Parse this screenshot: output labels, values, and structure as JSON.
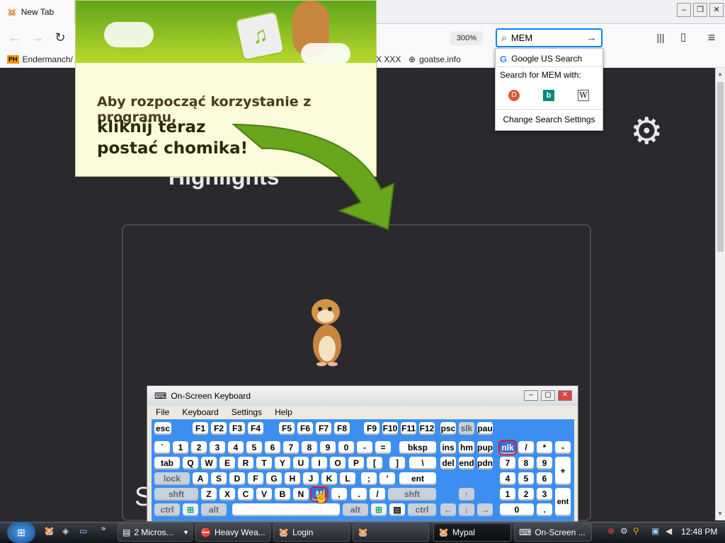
{
  "browser": {
    "tab_title": "New Tab",
    "zoom": "300%",
    "search": {
      "value": "MEM"
    },
    "bookmarks": [
      {
        "label": "Endermanch/",
        "icon": "PH"
      },
      {
        "label": "X XXX"
      },
      {
        "label": "goatse.info"
      }
    ],
    "search_popup": {
      "engine": "Google US Search",
      "search_with": "Search for MEM with:",
      "change_settings": "Change Search Settings"
    }
  },
  "page": {
    "heading": "Highlights",
    "side_letter": "S"
  },
  "ad": {
    "line1": "Aby rozpocząć korzystanie z programu,",
    "line2": "kliknij teraz",
    "line3": "postać chomika!"
  },
  "osk": {
    "title": "On-Screen Keyboard",
    "menu": [
      "File",
      "Keyboard",
      "Settings",
      "Help"
    ],
    "keys": {
      "esc": "esc",
      "f1": "F1",
      "f2": "F2",
      "f3": "F3",
      "f4": "F4",
      "f5": "F5",
      "f6": "F6",
      "f7": "F7",
      "f8": "F8",
      "f9": "F9",
      "f10": "F10",
      "f11": "F11",
      "f12": "F12",
      "psc": "psc",
      "slk": "slk",
      "pau": "pau",
      "grave": "`",
      "n1": "1",
      "n2": "2",
      "n3": "3",
      "n4": "4",
      "n5": "5",
      "n6": "6",
      "n7": "7",
      "n8": "8",
      "n9": "9",
      "n0": "0",
      "minus": "-",
      "equal": "=",
      "bksp": "bksp",
      "ins": "ins",
      "hm": "hm",
      "pup": "pup",
      "nlk": "nlk",
      "ndiv": "/",
      "nmul": "*",
      "nsub": "-",
      "tab": "tab",
      "q": "Q",
      "w": "W",
      "e": "E",
      "r": "R",
      "t": "T",
      "y": "Y",
      "u": "U",
      "i": "I",
      "o": "O",
      "p": "P",
      "lbr": "[",
      "rbr": "]",
      "bsl": "\\",
      "del": "del",
      "end": "end",
      "pdn": "pdn",
      "p7": "7",
      "p8": "8",
      "p9": "9",
      "padd": "+",
      "lock": "lock",
      "a": "A",
      "s": "S",
      "d": "D",
      "f": "F",
      "g": "G",
      "h": "H",
      "j": "J",
      "k": "K",
      "l": "L",
      "semi": ";",
      "quote": "'",
      "ent": "ent",
      "p4": "4",
      "p5": "5",
      "p6": "6",
      "shft": "shft",
      "z": "Z",
      "x": "X",
      "c": "C",
      "v": "V",
      "b": "B",
      "n": "N",
      "m": "M",
      "comma": ",",
      "dot": ".",
      "slash": "/",
      "rshft": "shft",
      "up": "↑",
      "p1": "1",
      "p2": "2",
      "p3": "3",
      "pent": "ent",
      "ctrl": "ctrl",
      "alt": "alt",
      "ralt": "alt",
      "rctrl": "ctrl",
      "left": "←",
      "down": "↓",
      "right": "→",
      "p0": "0",
      "pdot": "."
    }
  },
  "taskbar": {
    "items": [
      "2 Micros...",
      "Heavy Wea...",
      "Login",
      "",
      "Mypal",
      "On-Screen ..."
    ],
    "clock": "12:48 PM"
  },
  "colors": {
    "accent": "#0a84ff",
    "osk_bg": "#3c8ff0",
    "dark_bg": "#2a2a2e"
  }
}
